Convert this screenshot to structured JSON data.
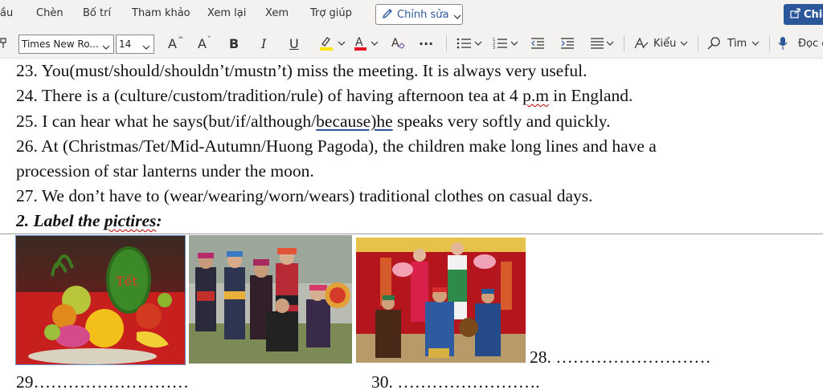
{
  "ribbon": {
    "tabs": [
      {
        "label": "ầu"
      },
      {
        "label": "Chèn"
      },
      {
        "label": "Bố trí"
      },
      {
        "label": "Tham khảo"
      },
      {
        "label": "Xem lại"
      },
      {
        "label": "Xem"
      },
      {
        "label": "Trợ giúp"
      }
    ],
    "edit_mode_label": "Chỉnh sửa",
    "share_label": "Chia"
  },
  "toolbar": {
    "font_family": "Times New Ro...",
    "font_size": "14",
    "grow_font": "A",
    "shrink_font": "A",
    "bold": "B",
    "italic": "I",
    "underline": "U",
    "highlight_color": "#ffe500",
    "font_color": "#e81123",
    "more": "···",
    "styles_label": "Kiểu",
    "find_label": "Tìm",
    "read_aloud_label": "Đọc c"
  },
  "document": {
    "lines": {
      "l23": "23. You(must/should/shouldn’t/mustn’t) miss the meeting. It is always very useful.",
      "l24a": "24. There is a (culture/custom/tradition/rule) of having afternoon tea at 4 ",
      "l24b": "p.m",
      "l24c": " in England.",
      "l25a": "25. I can hear what he says(but/if/although/",
      "l25b": "because)he",
      "l25c": " speaks very softly and quickly.",
      "l26a": "26. At (Christmas/Tet/Mid-Autumn/Huong Pagoda), the children make long lines and have a",
      "l26b": "procession of star lanterns under the moon.",
      "l27": "27. We don’t have to (wear/wearing/worn/wears) traditional clothes on casual days."
    },
    "heading_a": "2. Label the ",
    "heading_b": "pictires",
    "heading_c": ":",
    "blank_28": "28. ………………………",
    "blank_29": "29………………………",
    "blank_30": "30. ……………………."
  }
}
